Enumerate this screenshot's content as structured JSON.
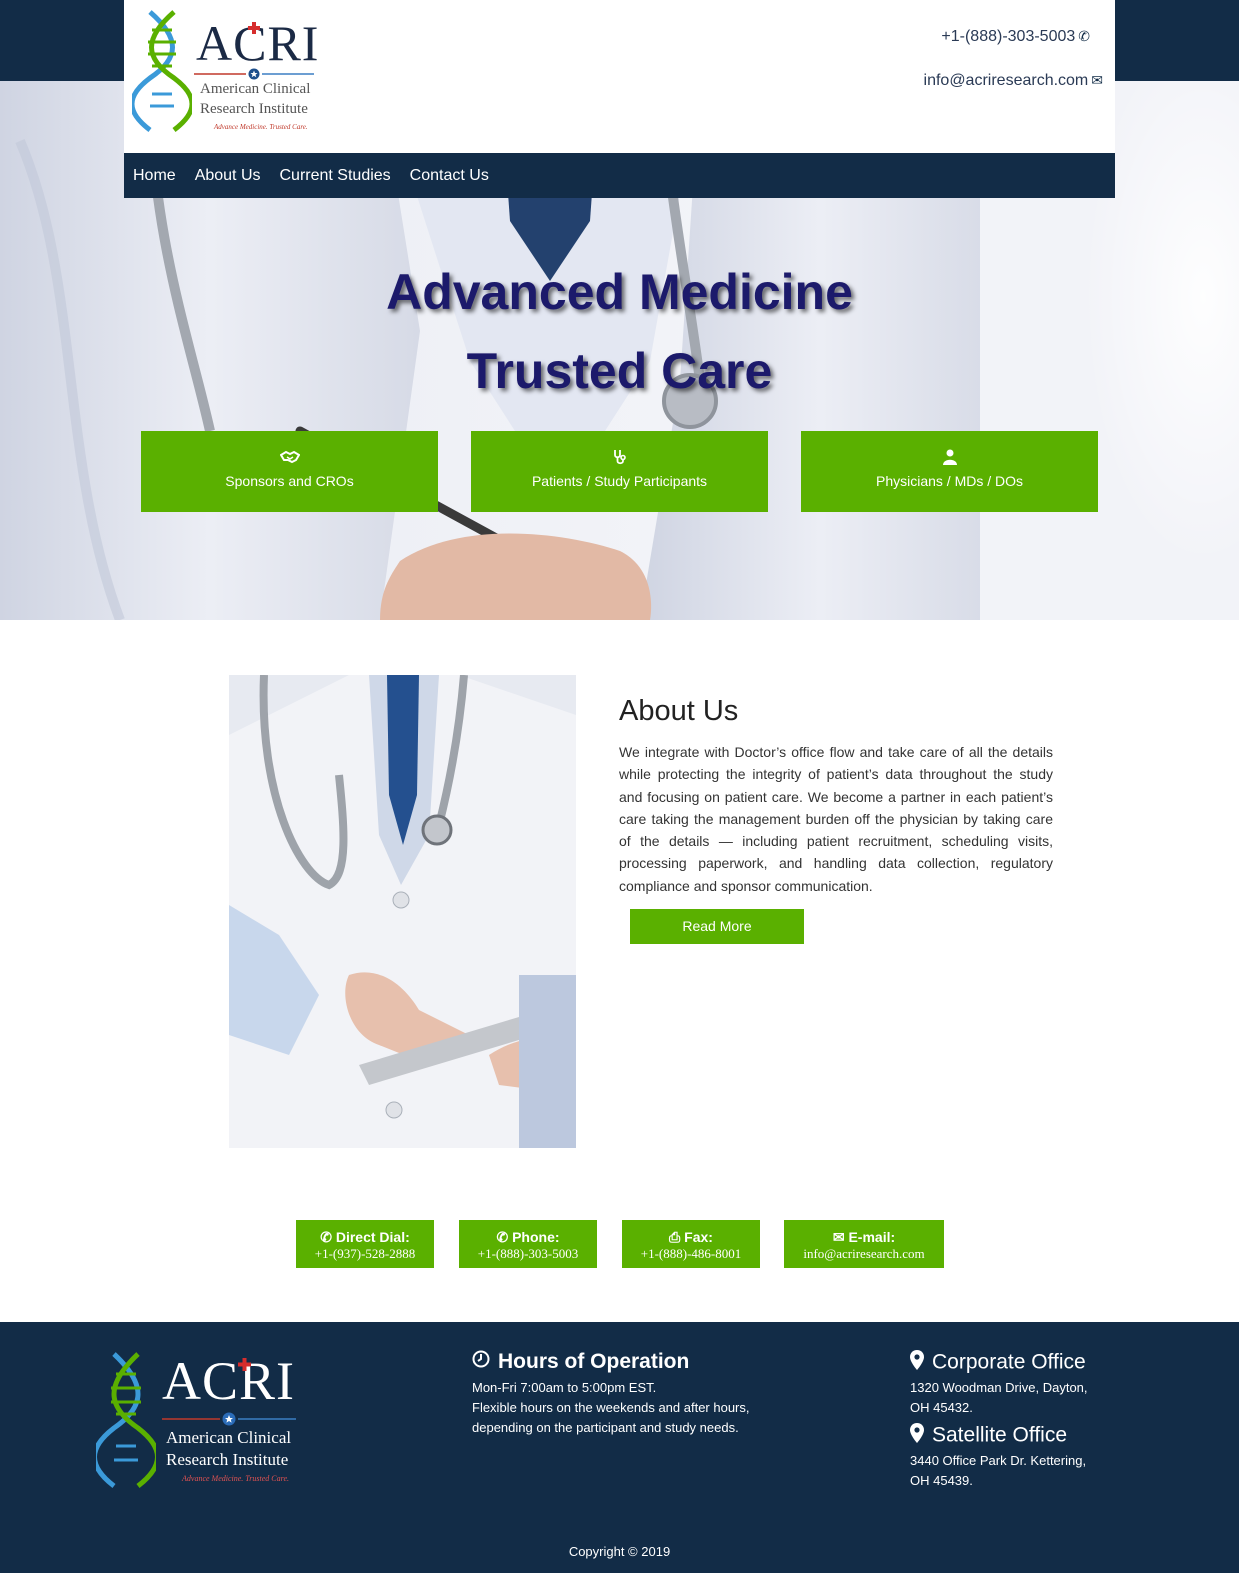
{
  "header": {
    "logo": {
      "name": "ACRI",
      "line1": "American Clinical",
      "line2": "Research Institute",
      "tagline": "Advance Medicine. Trusted Care."
    },
    "phone": "+1-(888)-303-5003",
    "email": "info@acriresearch.com"
  },
  "nav": {
    "items": [
      "Home",
      "About Us",
      "Current Studies",
      "Contact Us"
    ]
  },
  "hero": {
    "title_line1": "Advanced Medicine",
    "title_line2": "Trusted Care",
    "buttons": [
      {
        "label": "Sponsors and CROs",
        "icon": "handshake-icon"
      },
      {
        "label": "Patients / Study Participants",
        "icon": "stethoscope-icon"
      },
      {
        "label": "Physicians / MDs / DOs",
        "icon": "user-icon"
      }
    ]
  },
  "about": {
    "title": "About Us",
    "text": "We integrate with Doctor’s office flow and take care of all the details while protecting the integrity of patient’s data throughout the study and focusing on patient care. We become a partner in each patient’s care taking the management burden off the physician by taking care of the details — including patient recruitment, scheduling visits, processing paperwork, and handling data collection, regulatory compliance and sponsor communication.",
    "read_more": "Read More"
  },
  "contacts": [
    {
      "label": "Direct Dial:",
      "value": "+1-(937)-528-2888",
      "icon": "phone-icon"
    },
    {
      "label": "Phone:",
      "value": "+1-(888)-303-5003",
      "icon": "phone-icon"
    },
    {
      "label": "Fax:",
      "value": "+1-(888)-486-8001",
      "icon": "fax-icon"
    },
    {
      "label": "E-mail:",
      "value": "info@acriresearch.com",
      "icon": "envelope-icon"
    }
  ],
  "footer": {
    "hours": {
      "title": "Hours of Operation",
      "line1": "Mon-Fri 7:00am to 5:00pm EST.",
      "line2": "Flexible hours on the weekends and after hours,",
      "line3": "depending on the participant and study needs."
    },
    "corporate": {
      "title": "Corporate Office",
      "line1": "1320 Woodman Drive, Dayton,",
      "line2": "OH 45432."
    },
    "satellite": {
      "title": "Satellite Office",
      "line1": "3440 Office Park Dr. Kettering,",
      "line2": "OH 45439."
    },
    "copyright": "Copyright © 2019"
  },
  "colors": {
    "navy": "#122c47",
    "green": "#5ab000",
    "hero_title": "#1c1a6b"
  }
}
